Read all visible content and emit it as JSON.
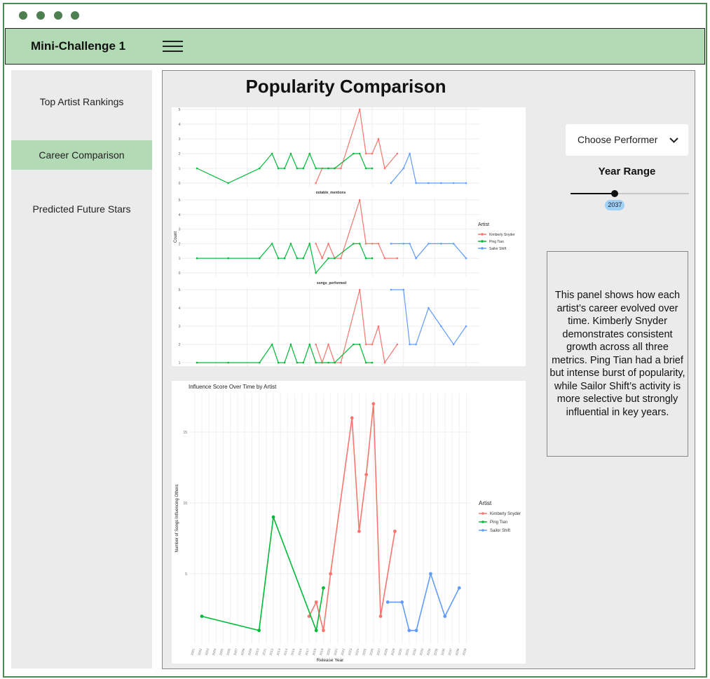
{
  "window": {
    "dots": [
      "#4e7f50",
      "#4e7f50",
      "#4e7f50",
      "#4e7f50"
    ]
  },
  "header": {
    "title": "Mini-Challenge 1",
    "menu_icon": "hamburger-icon"
  },
  "sidebar": {
    "items": [
      {
        "label": "Top Artist Rankings",
        "active": false
      },
      {
        "label": "Career Comparison",
        "active": true
      },
      {
        "label": "Predicted Future Stars",
        "active": false
      }
    ]
  },
  "main": {
    "title": "Popularity Comparison"
  },
  "controls": {
    "performer_placeholder": "Choose Performer",
    "year_range_label": "Year Range",
    "year_value": "2037",
    "slider_fraction": 0.375
  },
  "description": "This panel shows how each artist’s career evolved over time. Kimberly Snyder demonstrates consistent growth across all three metrics. Ping Tian had a brief but intense burst of popularity, while Sailor Shift’s activity is more selective but strongly influential in key years.",
  "colors": {
    "Kimberly Snyder": "#f8766d",
    "Ping Tian": "#00ba38",
    "Sailor Shift": "#619cff",
    "accent": "#b2dab4"
  },
  "chart_data": [
    {
      "type": "line",
      "ylabel": "Count",
      "legend_title": "Artist",
      "legend": [
        "Kimberly Snyder",
        "Ping Tian",
        "Sailor Shift"
      ],
      "legend_position": "right",
      "grid": true,
      "facet_labels": [
        "notable_mentions",
        "songs_performed"
      ],
      "panels": [
        {
          "ylim": [
            0,
            5
          ],
          "yticks": [
            0,
            1,
            2,
            3,
            4,
            5
          ],
          "series": [
            {
              "name": "Kimberly Snyder",
              "x": [
                2021,
                2022,
                2023,
                2024,
                2025,
                2028,
                2029,
                2030,
                2031,
                2032,
                2034
              ],
              "y": [
                0,
                1,
                1,
                1,
                1,
                5,
                2,
                2,
                3,
                1,
                2
              ]
            },
            {
              "name": "Ping Tian",
              "x": [
                2002,
                2007,
                2012,
                2014,
                2015,
                2016,
                2017,
                2018,
                2019,
                2020,
                2021,
                2023,
                2024,
                2027,
                2028,
                2029,
                2030
              ],
              "y": [
                1,
                0,
                1,
                2,
                1,
                1,
                2,
                1,
                1,
                2,
                1,
                1,
                1,
                2,
                2,
                1,
                1
              ]
            },
            {
              "name": "Sailor Shift",
              "x": [
                2033,
                2035,
                2036,
                2037,
                2039,
                2041,
                2043,
                2045
              ],
              "y": [
                0,
                1,
                2,
                0,
                0,
                0,
                0,
                0
              ]
            }
          ]
        },
        {
          "ylim": [
            0,
            5
          ],
          "yticks": [
            0,
            1,
            2,
            3,
            4,
            5
          ],
          "series": [
            {
              "name": "Kimberly Snyder",
              "x": [
                2021,
                2022,
                2023,
                2024,
                2025,
                2028,
                2029,
                2030,
                2031,
                2032,
                2034
              ],
              "y": [
                2,
                1,
                2,
                1,
                1,
                5,
                2,
                2,
                2,
                1,
                1
              ]
            },
            {
              "name": "Ping Tian",
              "x": [
                2002,
                2007,
                2012,
                2014,
                2015,
                2016,
                2017,
                2018,
                2019,
                2020,
                2021,
                2023,
                2024,
                2027,
                2028,
                2029,
                2030
              ],
              "y": [
                1,
                1,
                1,
                2,
                1,
                1,
                2,
                1,
                1,
                2,
                0,
                1,
                1,
                2,
                2,
                1,
                1
              ]
            },
            {
              "name": "Sailor Shift",
              "x": [
                2033,
                2035,
                2036,
                2037,
                2039,
                2041,
                2043,
                2045
              ],
              "y": [
                2,
                2,
                2,
                1,
                2,
                2,
                2,
                1
              ]
            }
          ]
        },
        {
          "ylim": [
            1,
            5
          ],
          "yticks": [
            1,
            2,
            3,
            4,
            5
          ],
          "series": [
            {
              "name": "Kimberly Snyder",
              "x": [
                2021,
                2022,
                2023,
                2024,
                2025,
                2028,
                2029,
                2030,
                2031,
                2032,
                2034
              ],
              "y": [
                2,
                1,
                2,
                1,
                1,
                5,
                2,
                2,
                3,
                1,
                2
              ]
            },
            {
              "name": "Ping Tian",
              "x": [
                2002,
                2007,
                2012,
                2014,
                2015,
                2016,
                2017,
                2018,
                2019,
                2020,
                2021,
                2023,
                2024,
                2027,
                2028,
                2029,
                2030
              ],
              "y": [
                1,
                1,
                1,
                2,
                1,
                1,
                2,
                1,
                1,
                2,
                1,
                1,
                1,
                2,
                2,
                1,
                1
              ]
            },
            {
              "name": "Sailor Shift",
              "x": [
                2033,
                2035,
                2036,
                2037,
                2039,
                2041,
                2043,
                2045
              ],
              "y": [
                5,
                5,
                2,
                2,
                4,
                3,
                2,
                3
              ]
            }
          ]
        }
      ]
    },
    {
      "type": "line",
      "title": "Influence Score Over Time by Artist",
      "xlabel": "Release Year",
      "ylabel": "Number of Songs Influencing Others",
      "legend_title": "Artist",
      "legend": [
        "Kimberly Snyder",
        "Ping Tian",
        "Sailor Shift"
      ],
      "legend_position": "right",
      "grid": true,
      "yticks": [
        5,
        10,
        15
      ],
      "xlim": [
        2001,
        2039
      ],
      "xticks": [
        "2001",
        "2002",
        "2003",
        "2004",
        "2005",
        "2006",
        "2007",
        "2008",
        "2009",
        "2010",
        "2011",
        "2012",
        "2013",
        "2014",
        "2015",
        "2016",
        "2017",
        "2018",
        "2019",
        "2020",
        "2021",
        "2022",
        "2023",
        "2024",
        "2025",
        "2026",
        "2027",
        "2028",
        "2029",
        "2030",
        "2031",
        "2032",
        "2033",
        "2034",
        "2035",
        "2036",
        "2037",
        "2038",
        "2039"
      ],
      "series": [
        {
          "name": "Kimberly Snyder",
          "x": [
            2017,
            2018,
            2019,
            2020,
            2023,
            2024,
            2025,
            2026,
            2027,
            2029
          ],
          "y": [
            2,
            3,
            1,
            5,
            16,
            8,
            12,
            17,
            2,
            8
          ]
        },
        {
          "name": "Ping Tian",
          "x": [
            2002,
            2010,
            2012,
            2018,
            2019
          ],
          "y": [
            2,
            1,
            9,
            1,
            4
          ]
        },
        {
          "name": "Sailor Shift",
          "x": [
            2028,
            2030,
            2031,
            2032,
            2034,
            2036,
            2038
          ],
          "y": [
            3,
            3,
            1,
            1,
            5,
            2,
            4
          ]
        }
      ]
    }
  ]
}
